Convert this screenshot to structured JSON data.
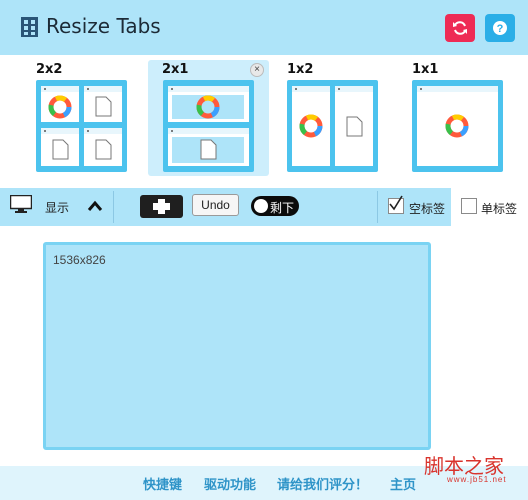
{
  "app": {
    "title": "Resize Tabs"
  },
  "layouts": [
    {
      "label": "2x2"
    },
    {
      "label": "2x1"
    },
    {
      "label": "1x2"
    },
    {
      "label": "1x1"
    }
  ],
  "toolbar": {
    "display_label": "显示",
    "undo_label": "Undo",
    "toggle_label": "剩下",
    "empty_tab_label": "空标签",
    "single_tab_label": "单标签"
  },
  "screen": {
    "resolution": "1536x826"
  },
  "footer": {
    "shortcuts": "快捷键",
    "drivers": "驱动功能",
    "rate": "请给我们评分！",
    "home": "主页"
  },
  "watermark": {
    "text": "脚本之家",
    "sub": "www.jb51.net"
  },
  "colors": {
    "header_bg": "#aee4f9",
    "refresh": "#ee2b55",
    "help": "#2aaee7",
    "link": "#2f94c8"
  }
}
